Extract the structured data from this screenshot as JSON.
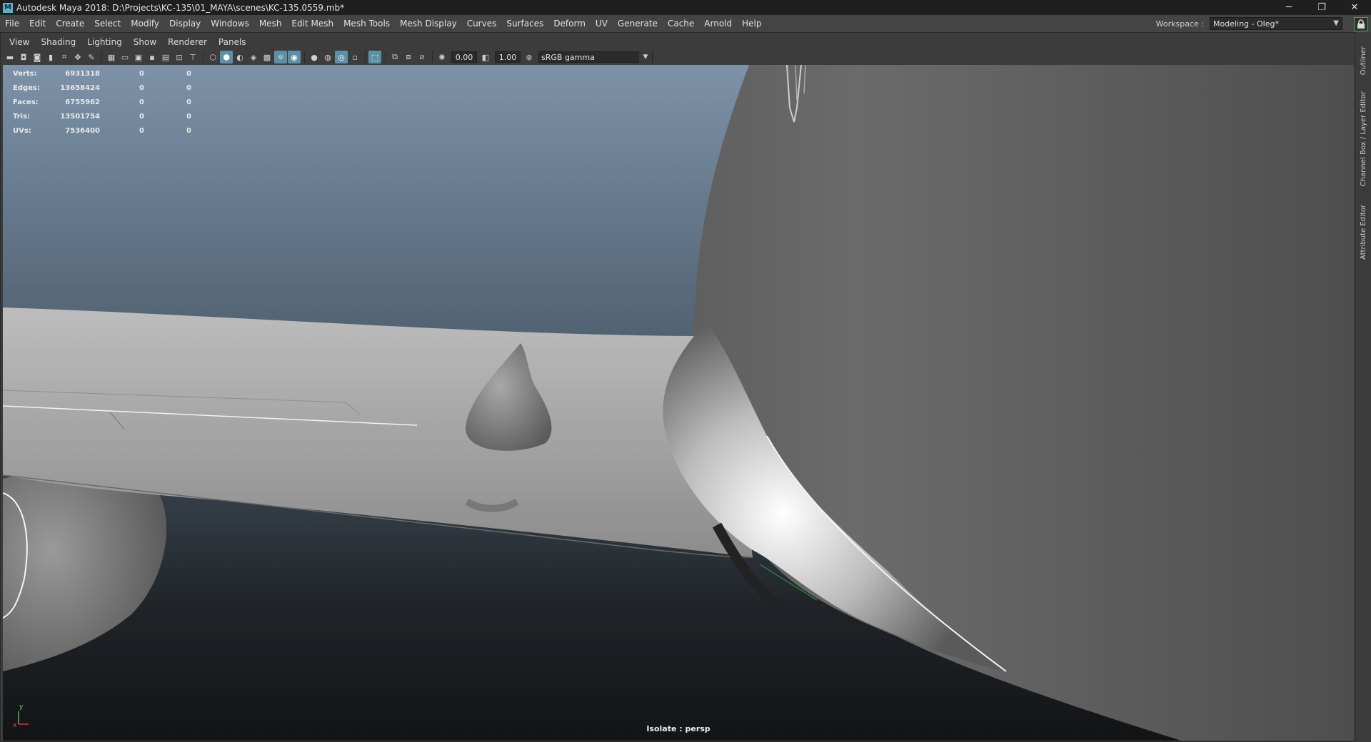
{
  "window": {
    "app_icon": "M",
    "title": "Autodesk Maya 2018: D:\\Projects\\KC-135\\01_MAYA\\scenes\\KC-135.0559.mb*",
    "buttons": {
      "minimize": "─",
      "restore": "❐",
      "close": "✕"
    }
  },
  "menubar": {
    "items": [
      "File",
      "Edit",
      "Create",
      "Select",
      "Modify",
      "Display",
      "Windows",
      "Mesh",
      "Edit Mesh",
      "Mesh Tools",
      "Mesh Display",
      "Curves",
      "Surfaces",
      "Deform",
      "UV",
      "Generate",
      "Cache",
      "Arnold",
      "Help"
    ],
    "workspace_label": "Workspace :",
    "workspace_value": "Modeling - Oleg*"
  },
  "panel": {
    "menus": [
      "View",
      "Shading",
      "Lighting",
      "Show",
      "Renderer",
      "Panels"
    ],
    "exposure": "0.00",
    "gamma": "1.00",
    "color_space": "sRGB gamma"
  },
  "hud": {
    "rows": [
      {
        "label": "Verts:",
        "v1": "6931318",
        "v2": "0",
        "v3": "0"
      },
      {
        "label": "Edges:",
        "v1": "13658424",
        "v2": "0",
        "v3": "0"
      },
      {
        "label": "Faces:",
        "v1": "6755962",
        "v2": "0",
        "v3": "0"
      },
      {
        "label": "Tris:",
        "v1": "13501754",
        "v2": "0",
        "v3": "0"
      },
      {
        "label": "UVs:",
        "v1": "7536400",
        "v2": "0",
        "v3": "0"
      }
    ]
  },
  "viewport": {
    "isolate_label": "Isolate : persp",
    "axis_y": "y",
    "axis_x": "x"
  },
  "side_tabs": {
    "outliner": "Outliner",
    "channel_box": "Channel Box / Layer Editor",
    "attribute_editor": "Attribute Editor"
  },
  "colors": {
    "accent": "#5d8fa6",
    "lock_green": "#3aa757"
  }
}
